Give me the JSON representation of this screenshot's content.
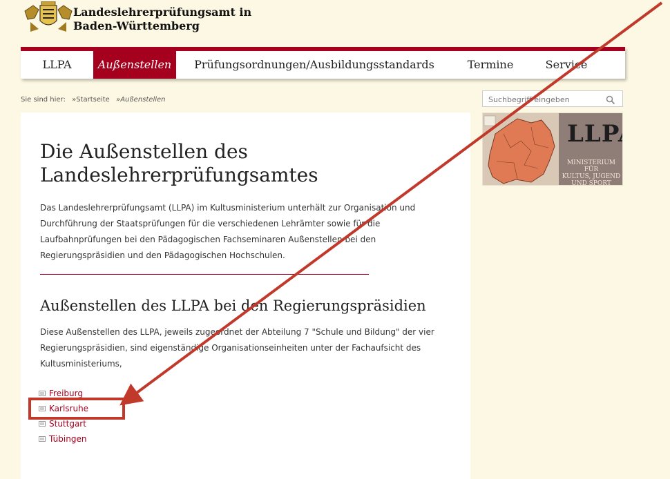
{
  "header": {
    "title_line1": "Landeslehrerprüfungsamt in",
    "title_line2": "Baden-Württemberg",
    "logo_icon": "coat-of-arms-icon"
  },
  "nav": {
    "items": [
      {
        "label": "LLPA"
      },
      {
        "label": "Außenstellen",
        "active": true
      },
      {
        "label": "Prüfungsordnungen/Ausbildungsstandards"
      },
      {
        "label": "Termine"
      },
      {
        "label": "Service"
      }
    ]
  },
  "breadcrumb": {
    "prefix": "Sie sind hier:",
    "home": "»Startseite",
    "current": "»Außenstellen"
  },
  "search": {
    "placeholder": "Suchbegriff eingeben",
    "icon": "search-icon"
  },
  "side_image": {
    "big_text": "LLPA",
    "sign_line1": "MINISTERIUM FÜR",
    "sign_line2": "KULTUS, JUGEND",
    "sign_line3": "UND SPORT"
  },
  "main": {
    "title": "Die Außenstellen des Landeslehrerprüfungsamtes",
    "intro": "Das Landeslehrerprüfungsamt (LLPA) im Kultusministerium unterhält zur Organisation und Durchführung der Staatsprüfungen für die verschiedenen Lehrämter sowie für die Laufbahnprüfungen bei den Pädagogischen Fachseminaren Außenstellen bei den Regierungspräsidien und den Pädagogischen Hochschulen.",
    "section_heading": "Außenstellen des LLPA bei den Regierungspräsidien",
    "section_text": "Diese Außenstellen des LLPA, jeweils zugeordnet der Abteilung 7 \"Schule und Bildung\" der vier Regierungspräsidien, sind eigenständige Organisationseinheiten unter der Fachaufsicht des Kultusministeriums,",
    "links": [
      {
        "label": "Freiburg"
      },
      {
        "label": "Karlsruhe"
      },
      {
        "label": "Stuttgart"
      },
      {
        "label": "Tübingen"
      }
    ]
  },
  "colors": {
    "accent": "#a5001e",
    "background": "#fdf8e4",
    "annotation": "#c0392b"
  }
}
